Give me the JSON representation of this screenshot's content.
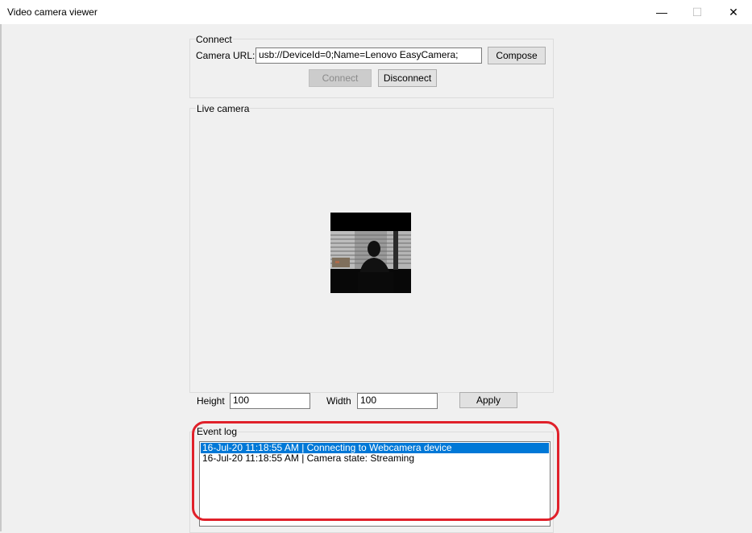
{
  "window": {
    "title": "Video camera viewer",
    "controls": {
      "minimize": "—",
      "maximize": "☐",
      "close": "✕"
    }
  },
  "connect": {
    "group_label": "Connect",
    "url_label": "Camera URL:",
    "url_value": "usb://DeviceId=0;Name=Lenovo EasyCamera;",
    "compose_label": "Compose",
    "connect_label": "Connect",
    "disconnect_label": "Disconnect"
  },
  "live": {
    "group_label": "Live camera"
  },
  "resize": {
    "height_label": "Height",
    "height_value": "100",
    "width_label": "Width",
    "width_value": "100",
    "apply_label": "Apply"
  },
  "event_log": {
    "group_label": "Event log",
    "entries": [
      {
        "text": "16-Jul-20 11:18:55 AM | Connecting to Webcamera device",
        "selected": true
      },
      {
        "text": "16-Jul-20 11:18:55 AM | Camera state: Streaming",
        "selected": false
      }
    ]
  },
  "colors": {
    "selection": "#0078d7",
    "highlight": "#e0202a"
  }
}
